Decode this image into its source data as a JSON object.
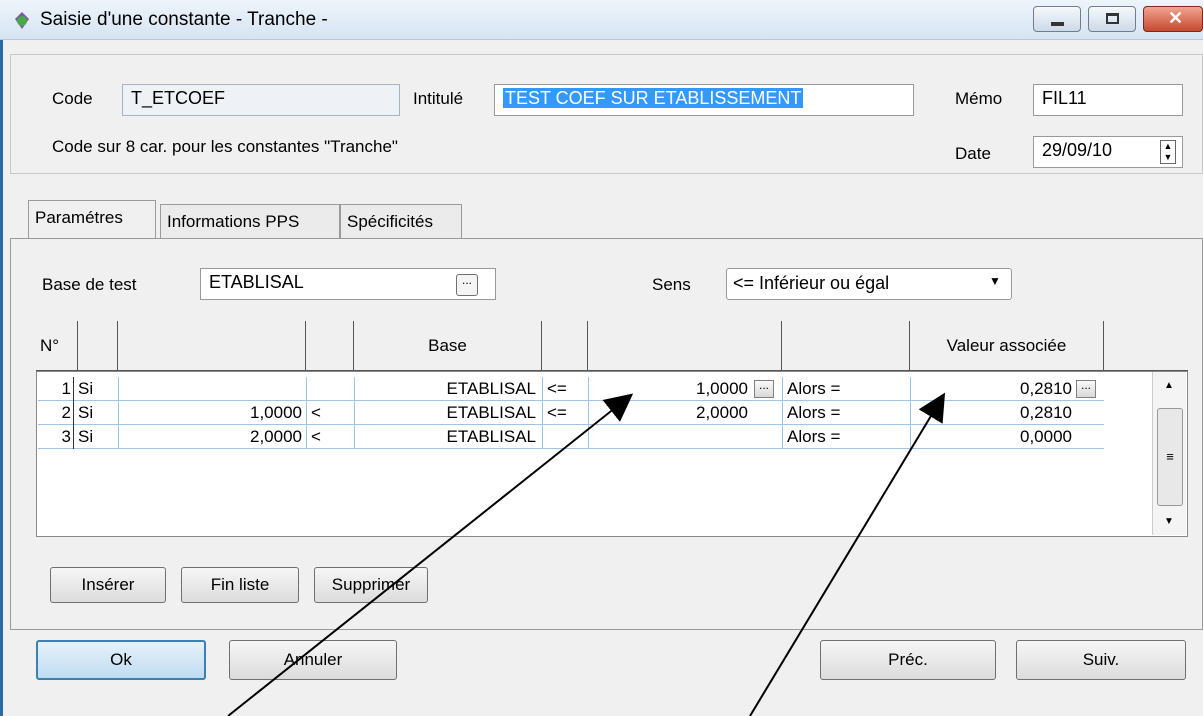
{
  "window": {
    "title": "Saisie d'une constante - Tranche -",
    "icon": "app-icon",
    "min": "minimize-icon",
    "max": "maximize-icon",
    "close": "close-icon"
  },
  "header": {
    "code_label": "Code",
    "code_value": "T_ETCOEF",
    "intitule_label": "Intitulé",
    "intitule_value": "TEST COEF SUR ETABLISSEMENT",
    "memo_label": "Mémo",
    "memo_value": "FIL11",
    "hint": "Code sur 8 car. pour les constantes \"Tranche\"",
    "date_label": "Date",
    "date_value": "29/09/10"
  },
  "tabs": [
    {
      "label": "Paramétres"
    },
    {
      "label": "Informations PPS"
    },
    {
      "label": "Spécificités"
    }
  ],
  "params": {
    "base_label": "Base de test",
    "base_value": "ETABLISAL",
    "ellipsis": "...",
    "sens_label": "Sens",
    "sens_value": "<= Inférieur ou égal"
  },
  "grid": {
    "headers": [
      "N°",
      "",
      "",
      "",
      "Base",
      "",
      "",
      "",
      "Valeur associée"
    ],
    "rows": [
      {
        "n": "1",
        "si": "Si",
        "low": "",
        "op1": "",
        "base": "ETABLISAL",
        "op2": "<=",
        "high": "1,0000",
        "alors": "Alors =",
        "val": "0,2810"
      },
      {
        "n": "2",
        "si": "Si",
        "low": "1,0000",
        "op1": "<",
        "base": "ETABLISAL",
        "op2": "<=",
        "high": "2,0000",
        "alors": "Alors =",
        "val": "0,2810"
      },
      {
        "n": "3",
        "si": "Si",
        "low": "2,0000",
        "op1": "<",
        "base": "ETABLISAL",
        "op2": "",
        "high": "",
        "alors": "Alors =",
        "val": "0,0000"
      }
    ]
  },
  "list_buttons": {
    "insert": "Insérer",
    "end": "Fin liste",
    "delete": "Supprimer"
  },
  "footer": {
    "ok": "Ok",
    "cancel": "Annuler",
    "prev": "Préc.",
    "next": "Suiv."
  }
}
